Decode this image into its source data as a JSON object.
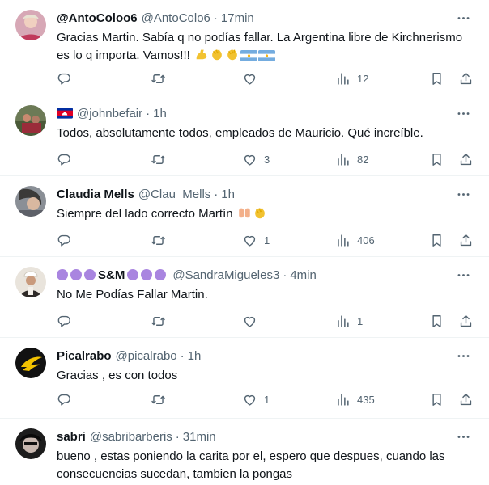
{
  "tweets": [
    {
      "name": "@AntoColoo6",
      "handle": "@AntoColo6",
      "time": "17min",
      "text": [
        "Gracias Martin. Sabía q no podías fallar. La Argentina libre de Kirchnerismo",
        "es lo q importa. Vamos!!!"
      ],
      "emojis": [
        "flexed-biceps",
        "clapping-hands",
        "clapping-hands",
        "argentina-flag",
        "argentina-flag"
      ],
      "replies": "",
      "retweets": "",
      "likes": "",
      "views": "12"
    },
    {
      "name": "",
      "flag": "cambodia-flag",
      "handle": "@johnbefair",
      "time": "1h",
      "text": [
        "Todos, absolutamente todos, empleados de Mauricio. Qué increíble."
      ],
      "replies": "",
      "retweets": "",
      "likes": "3",
      "views": "82"
    },
    {
      "name": "Claudia Mells",
      "handle": "@Clau_Mells",
      "time": "1h",
      "text": [
        "Siempre del lado correcto Martín"
      ],
      "emojis": [
        "raising-hands",
        "clapping-hands"
      ],
      "replies": "",
      "retweets": "",
      "likes": "1",
      "views": "406"
    },
    {
      "name": "S&M",
      "handle": "@SandraMigueles3",
      "time": "4min",
      "text": [
        "No Me Podías Fallar Martin."
      ],
      "replies": "",
      "retweets": "",
      "likes": "",
      "views": "1"
    },
    {
      "name": "Picalrabo",
      "handle": "@picalrabo",
      "time": "1h",
      "text": [
        "Gracias , es con todos"
      ],
      "replies": "",
      "retweets": "",
      "likes": "1",
      "views": "435"
    },
    {
      "name": "sabri",
      "handle": "@sabribarberis",
      "time": "31min",
      "text": [
        "bueno , estas poniendo la carita por el, espero que despues, cuando las",
        "consecuencias sucedan, tambien la pongas"
      ]
    }
  ],
  "separator": "·",
  "colors": {
    "text": "#0f1419",
    "muted": "#536471",
    "border": "#eff3f4",
    "heart": "#a985e0"
  },
  "icons": [
    "reply-icon",
    "retweet-icon",
    "like-icon",
    "views-icon",
    "bookmark-icon",
    "share-icon",
    "more-icon"
  ]
}
